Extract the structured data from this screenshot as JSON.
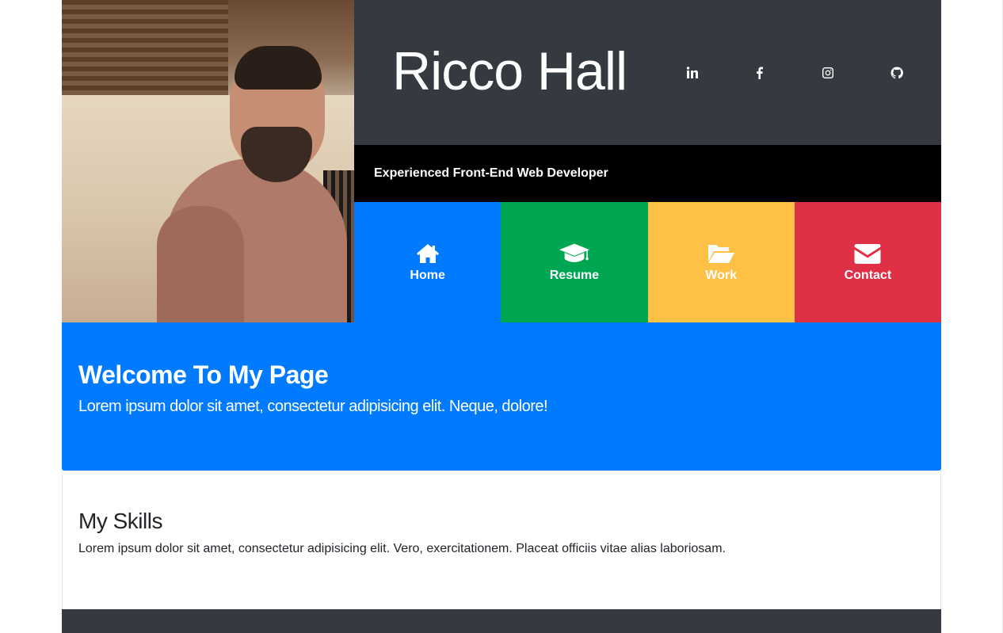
{
  "header": {
    "name": "Ricco Hall",
    "tagline": "Experienced Front-End Web Developer",
    "social": [
      {
        "icon": "linkedin-icon"
      },
      {
        "icon": "facebook-icon"
      },
      {
        "icon": "instagram-icon"
      },
      {
        "icon": "github-icon"
      }
    ]
  },
  "nav": [
    {
      "label": "Home",
      "icon": "home-icon",
      "color": "#007bff"
    },
    {
      "label": "Resume",
      "icon": "graduation-cap-icon",
      "color": "#00a651"
    },
    {
      "label": "Work",
      "icon": "folder-open-icon",
      "color": "#ffc145"
    },
    {
      "label": "Contact",
      "icon": "envelope-icon",
      "color": "#e03046"
    }
  ],
  "welcome": {
    "title": "Welcome To My Page",
    "text": "Lorem ipsum dolor sit amet, consectetur adipisicing elit. Neque, dolore!"
  },
  "skills": {
    "title": "My Skills",
    "text": "Lorem ipsum dolor sit amet, consectetur adipisicing elit. Vero, exercitationem. Placeat officiis vitae alias laboriosam."
  },
  "colors": {
    "header_dark": "#343a40",
    "tagline_bar": "#000000",
    "welcome_bg": "#007bff"
  }
}
